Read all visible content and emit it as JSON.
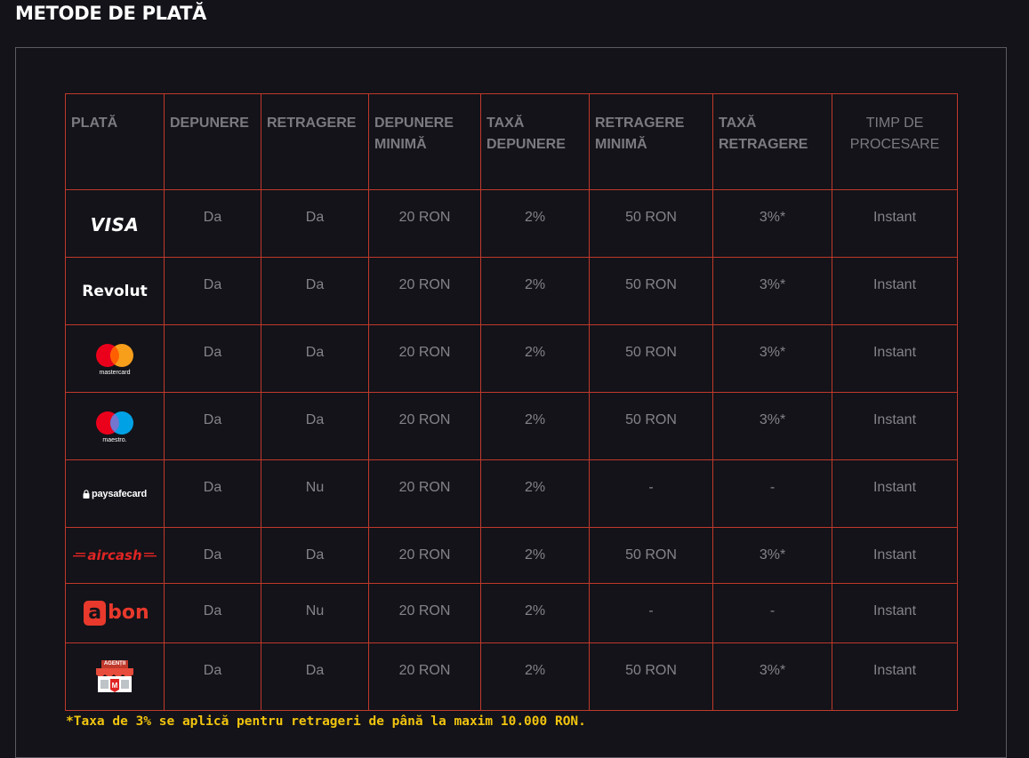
{
  "page": {
    "title": "METODE DE PLATĂ"
  },
  "table": {
    "headers": [
      "PLATĂ",
      "DEPUNERE",
      "RETRAGERE",
      "DEPUNERE MINIMĂ",
      "TAXĂ DEPUNERE",
      "RETRAGERE MINIMĂ",
      "TAXĂ RETRAGERE",
      "TIMP DE PROCESARE"
    ],
    "rows": [
      {
        "method": "VISA",
        "logo": "visa-logo",
        "deposit": "Da",
        "withdraw": "Da",
        "min_deposit": "20 RON",
        "deposit_fee": "2%",
        "min_withdraw": "50 RON",
        "withdraw_fee": "3%*",
        "processing": "Instant"
      },
      {
        "method": "Revolut",
        "logo": "revolut-logo",
        "deposit": "Da",
        "withdraw": "Da",
        "min_deposit": "20 RON",
        "deposit_fee": "2%",
        "min_withdraw": "50 RON",
        "withdraw_fee": "3%*",
        "processing": "Instant"
      },
      {
        "method": "mastercard",
        "logo": "mastercard-logo",
        "deposit": "Da",
        "withdraw": "Da",
        "min_deposit": "20 RON",
        "deposit_fee": "2%",
        "min_withdraw": "50 RON",
        "withdraw_fee": "3%*",
        "processing": "Instant"
      },
      {
        "method": "maestro.",
        "logo": "maestro-logo",
        "deposit": "Da",
        "withdraw": "Da",
        "min_deposit": "20 RON",
        "deposit_fee": "2%",
        "min_withdraw": "50 RON",
        "withdraw_fee": "3%*",
        "processing": "Instant"
      },
      {
        "method": "paysafecard",
        "logo": "paysafecard-logo",
        "deposit": "Da",
        "withdraw": "Nu",
        "min_deposit": "20 RON",
        "deposit_fee": "2%",
        "min_withdraw": "-",
        "withdraw_fee": "-",
        "processing": "Instant"
      },
      {
        "method": "aircash",
        "logo": "aircash-logo",
        "deposit": "Da",
        "withdraw": "Da",
        "min_deposit": "20 RON",
        "deposit_fee": "2%",
        "min_withdraw": "50 RON",
        "withdraw_fee": "3%*",
        "processing": "Instant"
      },
      {
        "method": "abon",
        "logo": "abon-logo",
        "deposit": "Da",
        "withdraw": "Nu",
        "min_deposit": "20 RON",
        "deposit_fee": "2%",
        "min_withdraw": "-",
        "withdraw_fee": "-",
        "processing": "Instant"
      },
      {
        "method": "AGENȚII",
        "logo": "agentii-logo",
        "deposit": "Da",
        "withdraw": "Da",
        "min_deposit": "20 RON",
        "deposit_fee": "2%",
        "min_withdraw": "50 RON",
        "withdraw_fee": "3%*",
        "processing": "Instant"
      }
    ]
  },
  "footnote": "*Taxa de 3% se aplică pentru retrageri de până la maxim 10.000 RON.",
  "colors": {
    "background": "#131319",
    "grid": "#c0392b",
    "note": "#f1c40f",
    "text": "#838389",
    "header": "#7a7a80"
  }
}
